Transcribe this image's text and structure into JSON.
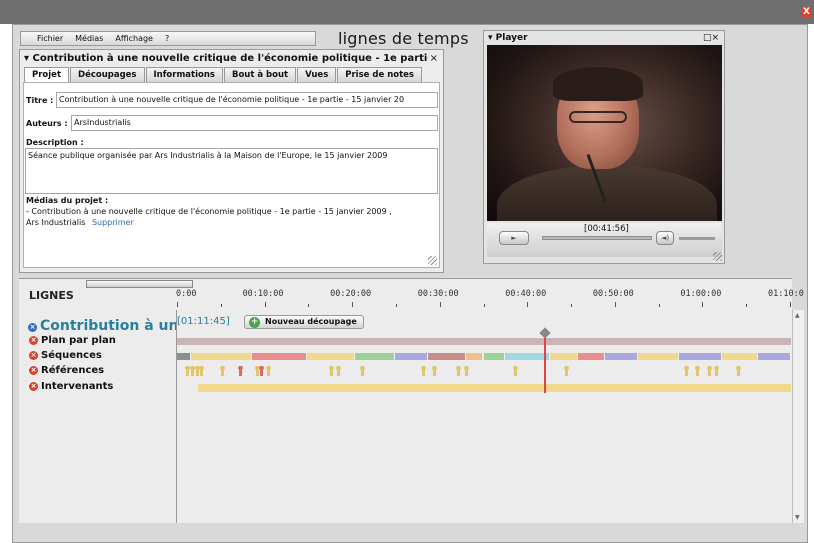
{
  "window": {
    "close_glyph": "X"
  },
  "menu": {
    "items": [
      "Fichier",
      "Médias",
      "Affichage",
      "?"
    ]
  },
  "app_title": "lignes de temps",
  "project": {
    "title": "▾ Contribution à une nouvelle critique de l'économie politique - 1e partie - 15 jan",
    "close_glyph": "×",
    "tabs": [
      "Projet",
      "Découpages",
      "Informations",
      "Bout à bout",
      "Vues",
      "Prise de notes"
    ],
    "active_tab": "Projet",
    "titre_label": "Titre :",
    "titre_value": "Contribution à une nouvelle critique de l'économie politique - 1e partie - 15 janvier 20",
    "auteurs_label": "Auteurs :",
    "auteurs_value": "ArsIndustrialis",
    "description_label": "Description :",
    "description_value": "Séance publique organisée par Ars Industrialis à la Maison de l'Europe, le 15 janvier 2009",
    "medias_label": "Médias du projet :",
    "media_line1": "- Contribution à une nouvelle critique de l'économie politique - 1e partie - 15 janvier 2009 ,",
    "media_line2": "Ars Industrialis",
    "supprimer": "Supprimer"
  },
  "player": {
    "title": "▾ Player",
    "controls_glyph": "□×",
    "timecode": "[00:41:56]",
    "play_glyph": "►",
    "volume_glyph": "◄)"
  },
  "timeline": {
    "lignes_label": "LIGNES",
    "ticks": [
      "0:00",
      "00:10:00",
      "00:20:00",
      "00:30:00",
      "00:40:00",
      "00:50:00",
      "01:00:00",
      "01:10:0"
    ],
    "track_title": "Contribution à une ...",
    "duration": "[01:11:45]",
    "new_button": "Nouveau découpage",
    "tracks": [
      "Plan par plan",
      "Séquences",
      "Références",
      "Intervenants"
    ],
    "playhead_minutes": 41.93,
    "total_minutes": 71.75,
    "sequence_colors": [
      "#8e8e8e",
      "#f0d98c",
      "#e88e8e",
      "#f0d98c",
      "#9cd19a",
      "#a9a9e0",
      "#c98c8c",
      "#f0bf8c",
      "#9cd19a",
      "#9fd9df",
      "#f0d98c",
      "#e88e8e",
      "#a9a9e0",
      "#f0d98c",
      "#a9a9e0",
      "#f0d98c",
      "#a9a9e0"
    ],
    "sequence_bounds_min": [
      0,
      1.6,
      8.6,
      14.9,
      20.3,
      24.9,
      28.7,
      33.0,
      35.0,
      37.4,
      42.6,
      45.8,
      48.9,
      52.6,
      57.3,
      62.2,
      66.3,
      71.75
    ],
    "reference_markers_min": [
      1.0,
      1.6,
      2.2,
      2.6,
      5.0,
      7.1,
      9.0,
      9.5,
      10.3,
      17.5,
      18.3,
      21.0,
      28.0,
      29.2,
      32.0,
      32.9,
      38.5,
      44.3,
      58.0,
      59.3,
      60.6,
      61.4,
      64.0
    ],
    "intervenants_range_min": [
      2.4,
      71.75
    ]
  }
}
